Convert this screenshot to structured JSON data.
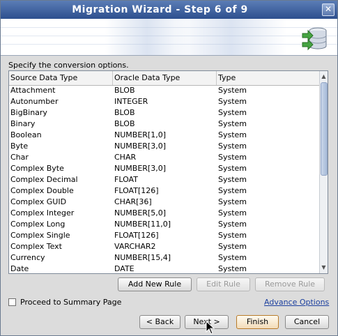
{
  "window": {
    "title": "Migration Wizard - Step 6 of 9",
    "close_glyph": "✕"
  },
  "instruction": "Specify the conversion options.",
  "table": {
    "columns": [
      "Source Data Type",
      "Oracle Data Type",
      "Type"
    ],
    "rows": [
      [
        "Attachment",
        "BLOB",
        "System"
      ],
      [
        "Autonumber",
        "INTEGER",
        "System"
      ],
      [
        "BigBinary",
        "BLOB",
        "System"
      ],
      [
        "Binary",
        "BLOB",
        "System"
      ],
      [
        "Boolean",
        "NUMBER[1,0]",
        "System"
      ],
      [
        "Byte",
        "NUMBER[3,0]",
        "System"
      ],
      [
        "Char",
        "CHAR",
        "System"
      ],
      [
        "Complex Byte",
        "NUMBER[3,0]",
        "System"
      ],
      [
        "Complex Decimal",
        "FLOAT",
        "System"
      ],
      [
        "Complex Double",
        "FLOAT[126]",
        "System"
      ],
      [
        "Complex GUID",
        "CHAR[36]",
        "System"
      ],
      [
        "Complex Integer",
        "NUMBER[5,0]",
        "System"
      ],
      [
        "Complex Long",
        "NUMBER[11,0]",
        "System"
      ],
      [
        "Complex Single",
        "FLOAT[126]",
        "System"
      ],
      [
        "Complex Text",
        "VARCHAR2",
        "System"
      ],
      [
        "Currency",
        "NUMBER[15,4]",
        "System"
      ],
      [
        "Date",
        "DATE",
        "System"
      ]
    ]
  },
  "rule_buttons": {
    "add": "Add New Rule",
    "edit": "Edit Rule",
    "remove": "Remove Rule"
  },
  "options": {
    "proceed_label": "Proceed to Summary Page",
    "proceed_checked": false,
    "advance_link": "Advance Options"
  },
  "nav_buttons": {
    "back": "< Back",
    "next": "Next >",
    "finish": "Finish",
    "cancel": "Cancel"
  },
  "icons": {
    "banner": "database-migration-icon",
    "close": "close-icon"
  }
}
